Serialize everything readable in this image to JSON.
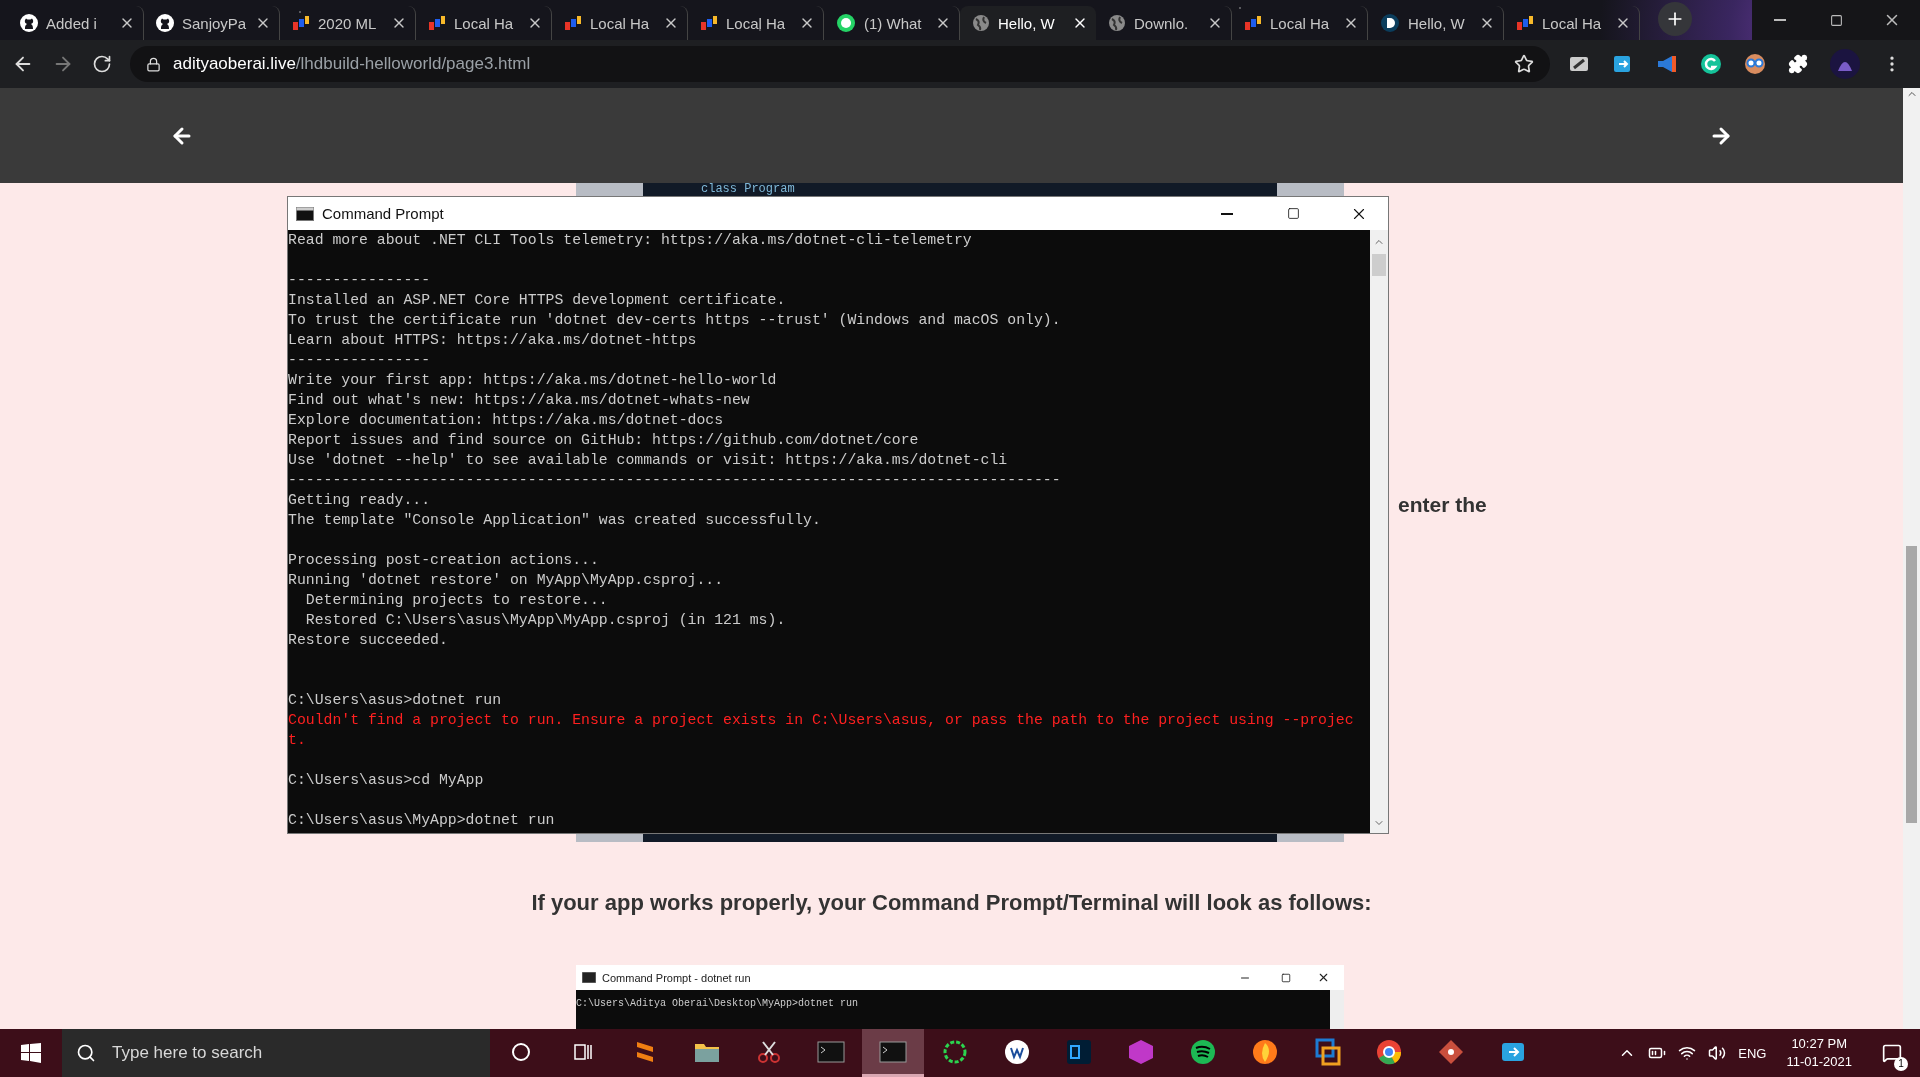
{
  "browser": {
    "tabs": [
      {
        "title": "Added i",
        "kind": "github",
        "selected": false
      },
      {
        "title": "SanjoyPa",
        "kind": "github",
        "selected": false
      },
      {
        "title": "2020 ML",
        "kind": "mlh",
        "selected": false
      },
      {
        "title": "Local Ha",
        "kind": "mlh",
        "selected": false
      },
      {
        "title": "Local Ha",
        "kind": "mlh",
        "selected": false
      },
      {
        "title": "Local Ha",
        "kind": "mlh",
        "selected": false
      },
      {
        "title": "(1) What",
        "kind": "chat",
        "selected": false
      },
      {
        "title": "Hello, W",
        "kind": "globe",
        "selected": true
      },
      {
        "title": "Downlo.",
        "kind": "globe",
        "selected": false
      },
      {
        "title": "Local Ha",
        "kind": "mlh",
        "selected": false
      },
      {
        "title": "Hello, W",
        "kind": "dcircle",
        "selected": false
      },
      {
        "title": "Local Ha",
        "kind": "mlh",
        "selected": false
      }
    ],
    "address": {
      "host": "adityaoberai.live",
      "path": "/lhdbuild-helloworld/page3.html"
    }
  },
  "page": {
    "snippet": "class Program",
    "side_text": "enter the",
    "heading": "If your app works properly, your Command Prompt/Terminal will look as follows:",
    "example_window": {
      "title": "Command Prompt - dotnet  run",
      "line": "C:\\Users\\Aditya Oberai\\Desktop\\MyApp>dotnet run"
    }
  },
  "cmd_window": {
    "title": "Command Prompt",
    "lines": [
      {
        "kind": "output",
        "text": "Read more about .NET CLI Tools telemetry: https://aka.ms/dotnet-cli-telemetry"
      },
      {
        "kind": "blank"
      },
      {
        "kind": "output",
        "text": "----------------"
      },
      {
        "kind": "output",
        "text": "Installed an ASP.NET Core HTTPS development certificate."
      },
      {
        "kind": "output",
        "text": "To trust the certificate run 'dotnet dev-certs https --trust' (Windows and macOS only)."
      },
      {
        "kind": "output",
        "text": "Learn about HTTPS: https://aka.ms/dotnet-https"
      },
      {
        "kind": "output",
        "text": "----------------"
      },
      {
        "kind": "output",
        "text": "Write your first app: https://aka.ms/dotnet-hello-world"
      },
      {
        "kind": "output",
        "text": "Find out what's new: https://aka.ms/dotnet-whats-new"
      },
      {
        "kind": "output",
        "text": "Explore documentation: https://aka.ms/dotnet-docs"
      },
      {
        "kind": "output",
        "text": "Report issues and find source on GitHub: https://github.com/dotnet/core"
      },
      {
        "kind": "output",
        "text": "Use 'dotnet --help' to see available commands or visit: https://aka.ms/dotnet-cli"
      },
      {
        "kind": "output",
        "text": "---------------------------------------------------------------------------------------"
      },
      {
        "kind": "output",
        "text": "Getting ready..."
      },
      {
        "kind": "output",
        "text": "The template \"Console Application\" was created successfully."
      },
      {
        "kind": "blank"
      },
      {
        "kind": "output",
        "text": "Processing post-creation actions..."
      },
      {
        "kind": "output",
        "text": "Running 'dotnet restore' on MyApp\\MyApp.csproj..."
      },
      {
        "kind": "output",
        "text": "  Determining projects to restore..."
      },
      {
        "kind": "output",
        "text": "  Restored C:\\Users\\asus\\MyApp\\MyApp.csproj (in 121 ms)."
      },
      {
        "kind": "output",
        "text": "Restore succeeded."
      },
      {
        "kind": "blank"
      },
      {
        "kind": "blank"
      },
      {
        "kind": "output",
        "text": "C:\\Users\\asus>dotnet run"
      },
      {
        "kind": "error",
        "text": "Couldn't find a project to run. Ensure a project exists in C:\\Users\\asus, or pass the path to the project using --projec"
      },
      {
        "kind": "error",
        "text": "t."
      },
      {
        "kind": "blank"
      },
      {
        "kind": "output",
        "text": "C:\\Users\\asus>cd MyApp"
      },
      {
        "kind": "blank"
      },
      {
        "kind": "output",
        "text": "C:\\Users\\asus\\MyApp>dotnet run"
      }
    ]
  },
  "taskbar": {
    "search_placeholder": "Type here to search",
    "apps": [
      {
        "kind": "sublime",
        "selected": false
      },
      {
        "kind": "folder",
        "selected": false
      },
      {
        "kind": "snip",
        "selected": false
      },
      {
        "kind": "terminal",
        "selected": false
      },
      {
        "kind": "terminal",
        "selected": true
      },
      {
        "kind": "ring",
        "selected": false
      },
      {
        "kind": "wcircle",
        "selected": false
      },
      {
        "kind": "ps",
        "selected": false
      },
      {
        "kind": "cube",
        "selected": false
      },
      {
        "kind": "spotify",
        "selected": false
      },
      {
        "kind": "firefox",
        "selected": false
      },
      {
        "kind": "vbox",
        "selected": false
      },
      {
        "kind": "chrome",
        "selected": false
      },
      {
        "kind": "git",
        "selected": false
      },
      {
        "kind": "share",
        "selected": false
      }
    ],
    "language": "ENG",
    "time": "10:27 PM",
    "date": "11-01-2021",
    "notifications": "1"
  }
}
